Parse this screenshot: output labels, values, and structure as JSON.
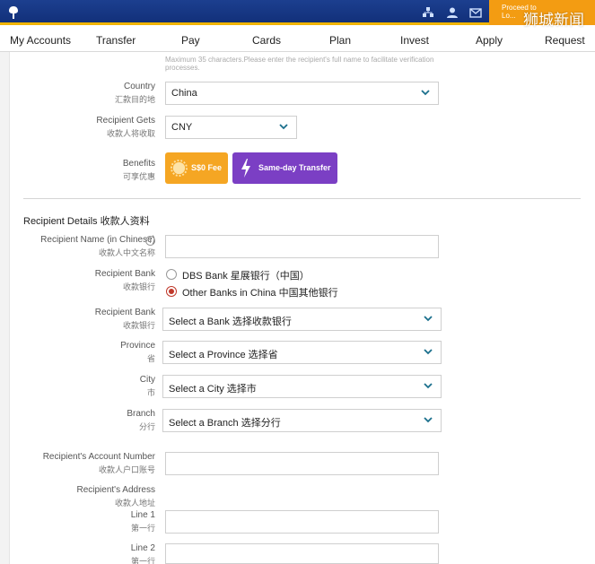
{
  "header": {
    "proceed_line1": "Proceed to",
    "proceed_line2": "Lo...",
    "watermark": "狮城新闻"
  },
  "nav": {
    "items": [
      "My Accounts",
      "Transfer",
      "Pay",
      "Cards",
      "Plan",
      "Invest",
      "Apply",
      "Request"
    ]
  },
  "form": {
    "hint": "Maximum 35 characters.Please enter the recipient's full name to facilitate verification processes.",
    "country": {
      "label": "Country",
      "label_cn": "汇款目的地",
      "value": "China"
    },
    "recipient_gets": {
      "label": "Recipient Gets",
      "label_cn": "收款人将收取",
      "value": "CNY"
    },
    "benefits": {
      "label": "Benefits",
      "label_cn": "可享优惠",
      "fee": "S$0 Fee",
      "transfer": "Same-day Transfer",
      "fee_color": "#f5a623",
      "transfer_color": "#7b3fc4"
    }
  },
  "recipient": {
    "section_title": "Recipient Details 收款人资料",
    "name_cn": {
      "label": "Recipient Name (in Chinese)",
      "label_cn": "收款人中文名称",
      "info": "i",
      "value": ""
    },
    "bank_type": {
      "label": "Recipient Bank",
      "label_cn": "收款银行",
      "options": [
        "DBS Bank 星展银行（中国）",
        "Other Banks in China 中国其他银行"
      ],
      "selected": "Other Banks in China 中国其他银行"
    },
    "bank": {
      "label": "Recipient Bank",
      "label_cn": "收款银行",
      "value": "Select a Bank 选择收款银行"
    },
    "province": {
      "label": "Province",
      "label_cn": "省",
      "value": "Select a Province 选择省"
    },
    "city": {
      "label": "City",
      "label_cn": "市",
      "value": "Select a City 选择市"
    },
    "branch": {
      "label": "Branch",
      "label_cn": "分行",
      "value": "Select a Branch 选择分行"
    },
    "account": {
      "label": "Recipient's Account Number",
      "label_cn": "收款人户口账号",
      "value": ""
    },
    "address": {
      "label": "Recipient's Address",
      "label_cn": "收款人地址"
    },
    "line1": {
      "label": "Line 1",
      "label_cn": "第一行",
      "value": ""
    },
    "line2": {
      "label": "Line 2",
      "label_cn": "第一行",
      "value": ""
    }
  },
  "colors": {
    "header_blue": "#12307a",
    "accent_orange": "#f39c12",
    "radio_red": "#c0392b",
    "chevron_teal": "#1a6f8c"
  }
}
